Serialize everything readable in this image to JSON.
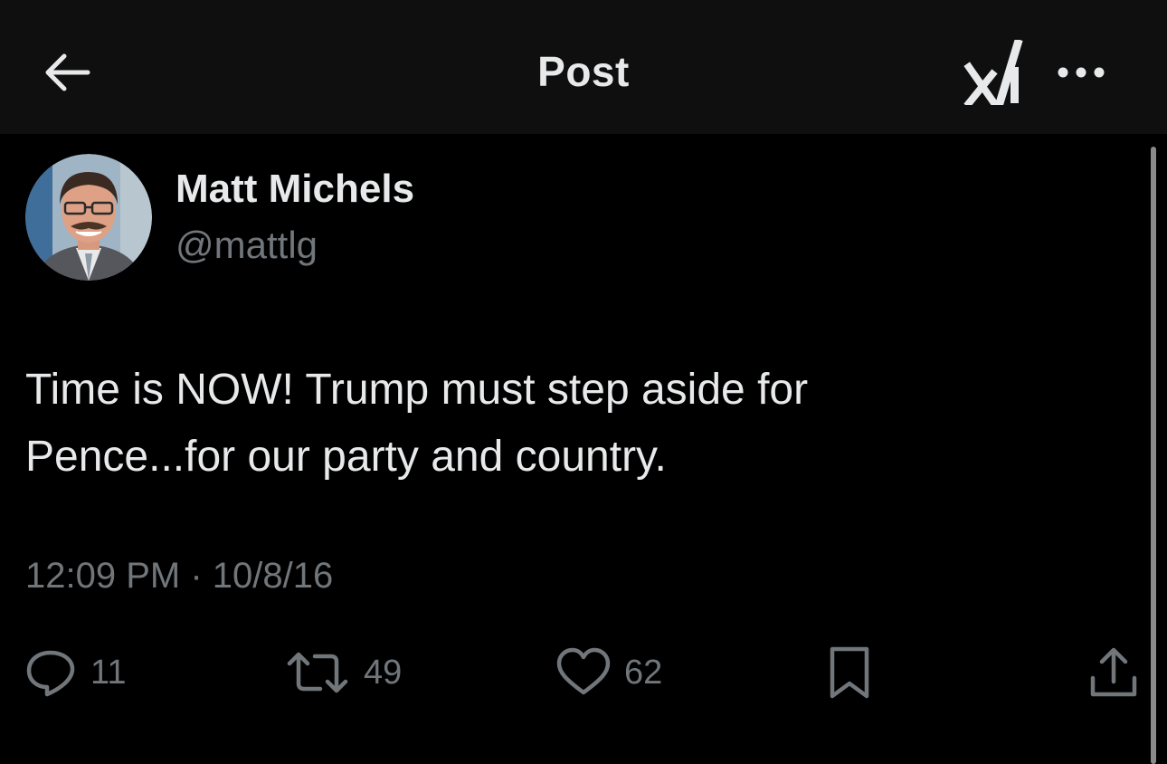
{
  "header": {
    "title": "Post",
    "back_icon": "arrow-left-icon",
    "grok_icon": "grok-icon",
    "more_icon": "more-horizontal-icon"
  },
  "author": {
    "name": "Matt Michels",
    "handle": "@mattlg"
  },
  "post": {
    "text": "Time is NOW! Trump must step aside for Pence...for our party and country.",
    "timestamp": "12:09 PM · 10/8/16"
  },
  "actions": {
    "replies": "11",
    "reposts": "49",
    "likes": "62"
  },
  "colors": {
    "background": "#000000",
    "header_background": "#0f0f0f",
    "primary_text": "#e7e9ea",
    "secondary_text": "#71767b"
  }
}
